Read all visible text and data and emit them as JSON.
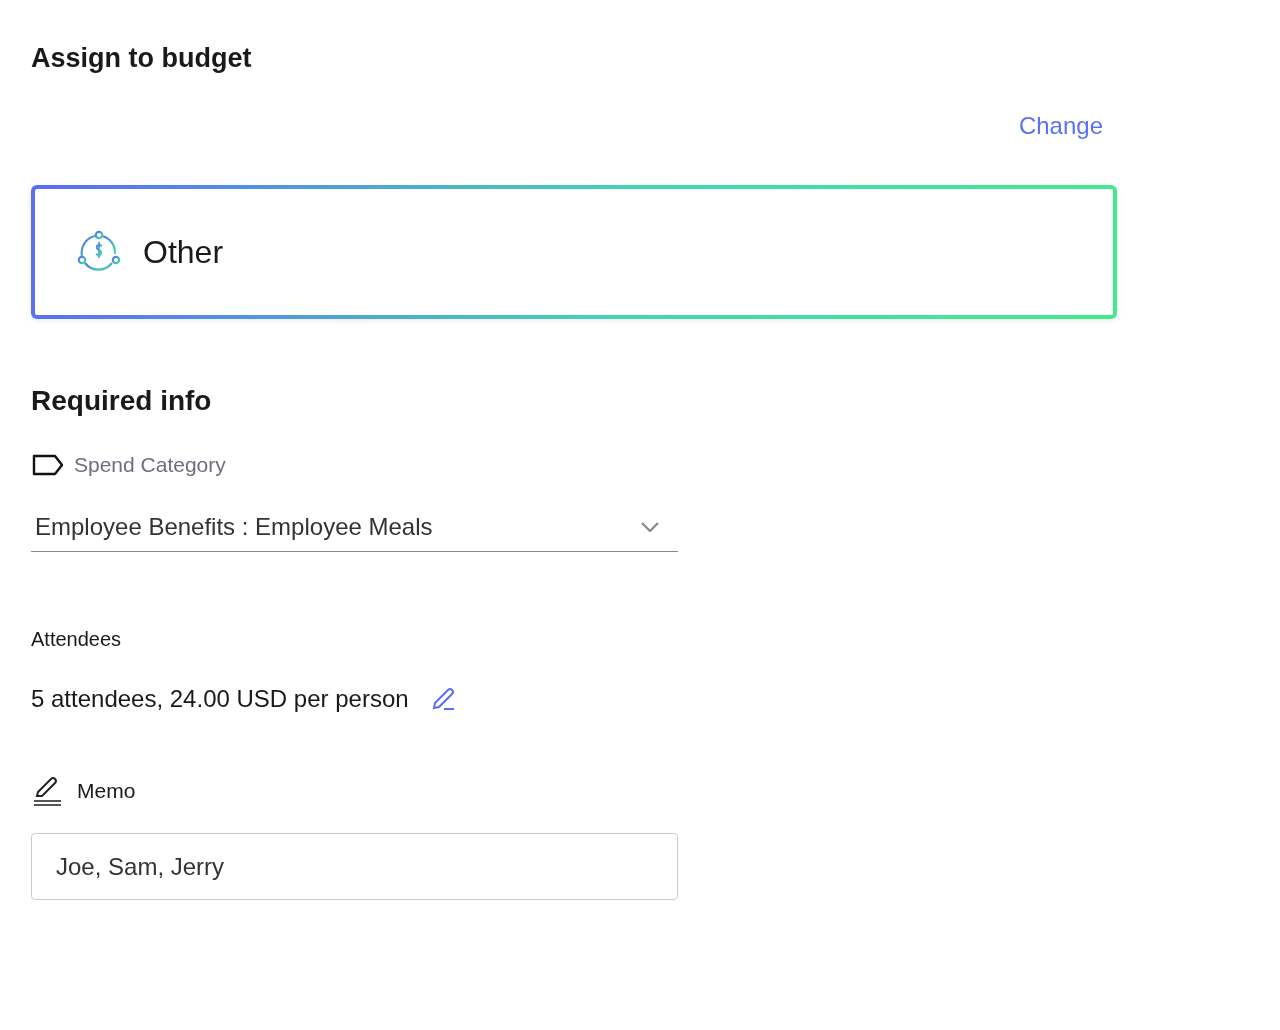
{
  "title": "Assign to budget",
  "change_link": "Change",
  "budget": {
    "name": "Other"
  },
  "required_info": {
    "heading": "Required info",
    "spend_category": {
      "label": "Spend Category",
      "value": "Employee Benefits : Employee Meals"
    },
    "attendees": {
      "label": "Attendees",
      "summary": "5 attendees, 24.00 USD per person"
    },
    "memo": {
      "label": "Memo",
      "value": "Joe, Sam, Jerry"
    }
  }
}
